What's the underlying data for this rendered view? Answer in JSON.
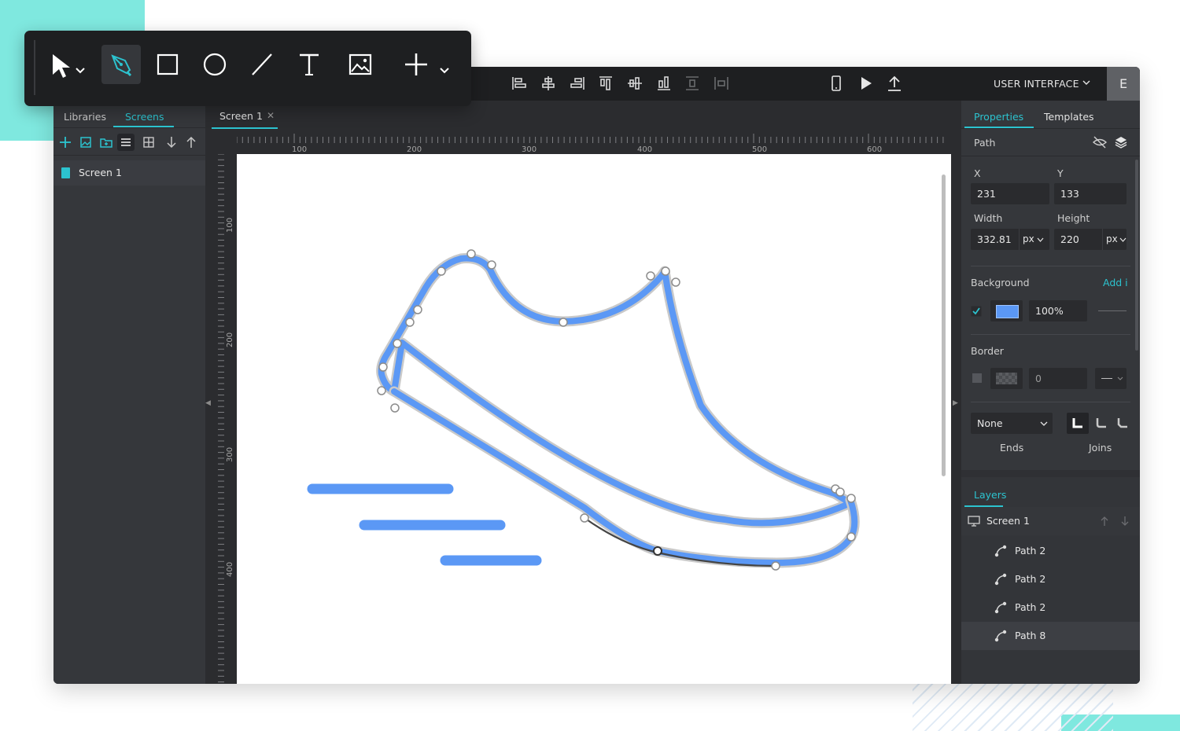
{
  "colors": {
    "accent": "#2cc3cf",
    "path_blue": "#5b98f5",
    "topbar": "#1e1f21",
    "panel": "#35373b"
  },
  "floating_toolbar": {
    "tools": [
      "pointer-icon",
      "pen-icon",
      "rectangle-icon",
      "ellipse-icon",
      "line-icon",
      "text-icon",
      "image-icon",
      "plus-icon"
    ]
  },
  "topbar": {
    "align_icons": [
      "align-left-icon",
      "align-center-horizontal-icon",
      "align-right-icon",
      "align-top-icon",
      "align-middle-icon",
      "align-bottom-icon",
      "distribute-horizontal-icon",
      "distribute-vertical-icon"
    ],
    "preview_icons": [
      "device-icon",
      "play-icon",
      "export-icon"
    ],
    "mode_label": "USER INTERFACE",
    "user_initial": "E"
  },
  "left_panel": {
    "tabs": [
      "Libraries",
      "Screens"
    ],
    "active_tab": "Screens",
    "screens": [
      {
        "label": "Screen 1"
      }
    ]
  },
  "document": {
    "tab_label": "Screen 1",
    "ruler_h": [
      "100",
      "200",
      "300",
      "400",
      "500",
      "600"
    ],
    "ruler_v": [
      "100",
      "200",
      "300",
      "400"
    ]
  },
  "properties": {
    "tabs": [
      "Properties",
      "Templates"
    ],
    "element_type": "Path",
    "x_label": "X",
    "x": "231",
    "y_label": "Y",
    "y": "133",
    "width_label": "Width",
    "width": "332.81",
    "width_unit": "px",
    "height_label": "Height",
    "height": "220",
    "height_unit": "px",
    "background_label": "Background",
    "add_link": "Add i",
    "background_color": "#5b98f5",
    "background_opacity": "100%",
    "border_label": "Border",
    "border_value": "0",
    "ends_select": "None",
    "ends_label": "Ends",
    "joins_label": "Joins"
  },
  "layers": {
    "title": "Layers",
    "root": "Screen 1",
    "items": [
      {
        "label": "Path 2"
      },
      {
        "label": "Path 2"
      },
      {
        "label": "Path 2"
      },
      {
        "label": "Path 8"
      }
    ]
  }
}
